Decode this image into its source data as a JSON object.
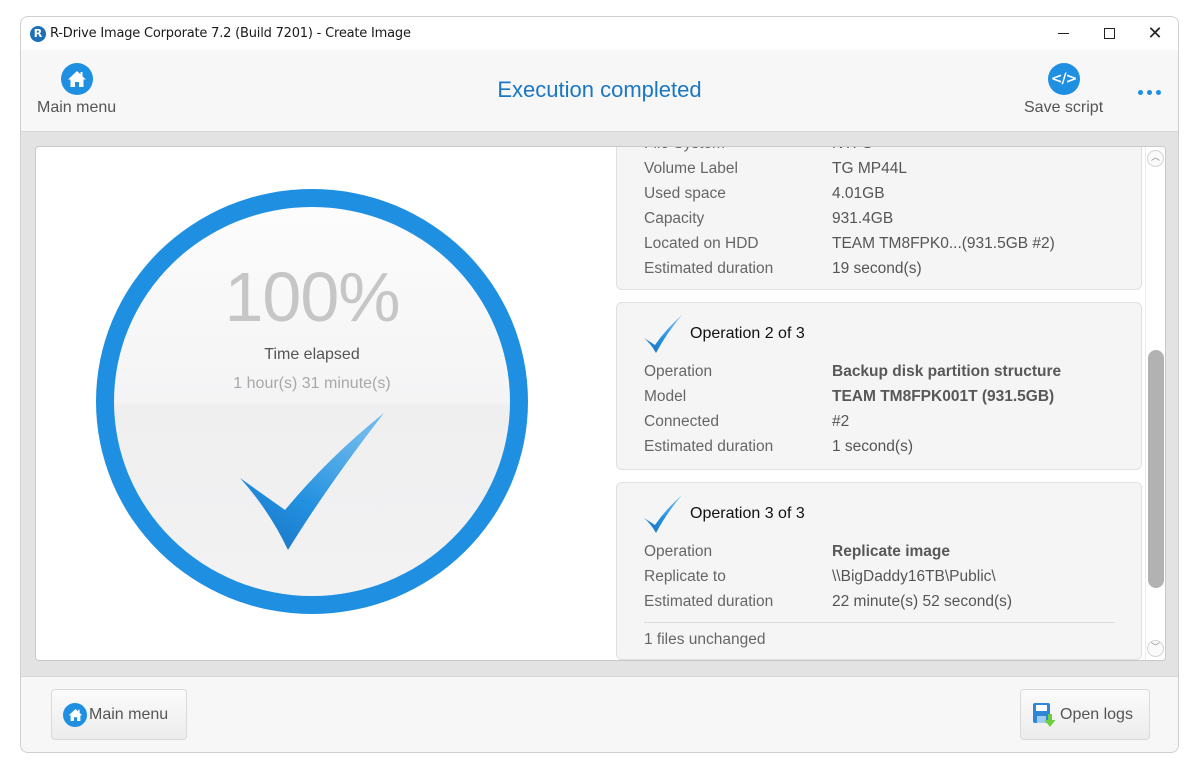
{
  "window": {
    "title": "R-Drive Image Corporate 7.2 (Build 7201) - Create Image",
    "controls": [
      "minimize",
      "maximize",
      "close"
    ]
  },
  "toolbar": {
    "main_menu_label": "Main menu",
    "page_title": "Execution completed",
    "save_script_label": "Save script",
    "icons": {
      "main_menu": "home-icon",
      "save_script": "code-icon",
      "more": "more-horizontal-icon"
    }
  },
  "progress": {
    "percent_label": "100%",
    "percent": 100,
    "elapsed_label": "Time elapsed",
    "elapsed_value": "1 hour(s) 31 minute(s)",
    "status_icon": "checkmark-icon"
  },
  "operations": {
    "partial_card": {
      "rows": [
        {
          "key": "File System",
          "value": "NTFS"
        },
        {
          "key": "Volume Label",
          "value": "TG MP44L"
        },
        {
          "key": "Used space",
          "value": "4.01GB"
        },
        {
          "key": "Capacity",
          "value": "931.4GB"
        },
        {
          "key": "Located on HDD",
          "value": "TEAM TM8FPK0...(931.5GB #2)"
        },
        {
          "key": "Estimated duration",
          "value": "19 second(s)"
        }
      ]
    },
    "cards": [
      {
        "title": "Operation 2 of 3",
        "rows": [
          {
            "key": "Operation",
            "value": "Backup disk partition structure"
          },
          {
            "key": "Model",
            "value": "TEAM TM8FPK001T (931.5GB)"
          },
          {
            "key": "Connected",
            "value": "#2"
          },
          {
            "key": "Estimated duration",
            "value": "1 second(s)"
          }
        ]
      },
      {
        "title": "Operation 3 of 3",
        "rows": [
          {
            "key": "Operation",
            "value": "Replicate image"
          },
          {
            "key": "Replicate to",
            "value": "\\\\BigDaddy16TB\\Public\\"
          },
          {
            "key": "Estimated duration",
            "value": "22 minute(s) 52 second(s)"
          }
        ],
        "note": "1 files unchanged"
      }
    ]
  },
  "footer": {
    "main_menu_label": "Main menu",
    "open_logs_label": "Open logs"
  },
  "colors": {
    "accent": "#1e8fe1",
    "title_text": "#1b77c4",
    "percent_text": "#c6c6c6"
  }
}
